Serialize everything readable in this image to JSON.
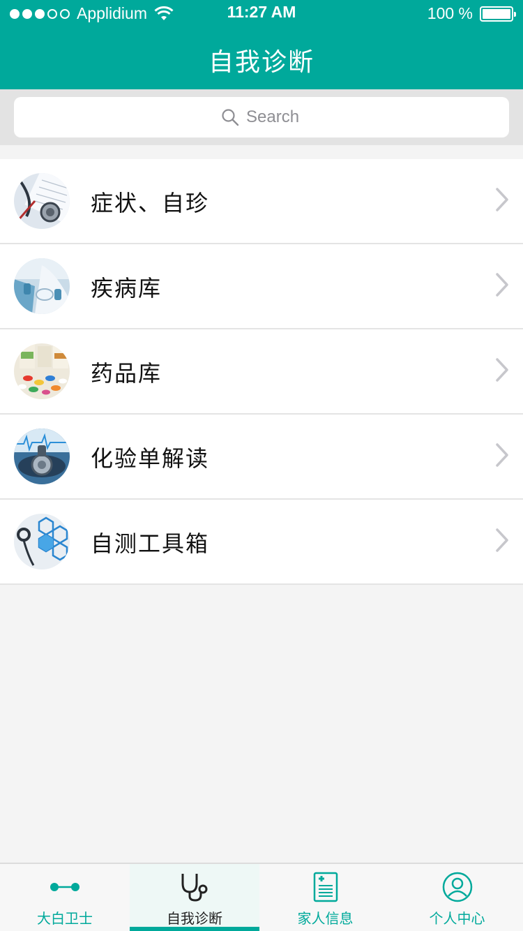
{
  "status_bar": {
    "carrier": "Applidium",
    "time": "11:27 AM",
    "battery": "100 %",
    "signal_dots_filled": 3,
    "signal_dots_total": 5
  },
  "header": {
    "title": "自我诊断"
  },
  "search": {
    "placeholder": "Search"
  },
  "menu": {
    "items": [
      {
        "label": "症状、自珍",
        "icon": "stethoscope-chart-image"
      },
      {
        "label": "疾病库",
        "icon": "lab-scientist-image"
      },
      {
        "label": "药品库",
        "icon": "pills-image"
      },
      {
        "label": "化验单解读",
        "icon": "stethoscope-ecg-image"
      },
      {
        "label": "自测工具箱",
        "icon": "medical-hexagon-image"
      }
    ]
  },
  "tabbar": {
    "tabs": [
      {
        "label": "大白卫士",
        "icon": "connector-dots-icon"
      },
      {
        "label": "自我诊断",
        "icon": "stethoscope-icon",
        "active": true
      },
      {
        "label": "家人信息",
        "icon": "medical-record-icon"
      },
      {
        "label": "个人中心",
        "icon": "user-circle-icon"
      }
    ]
  },
  "colors": {
    "primary": "#00a99b",
    "background": "#f4f4f4",
    "search_bg": "#e3e3e3",
    "tab_active_bg": "#eef8f6"
  }
}
